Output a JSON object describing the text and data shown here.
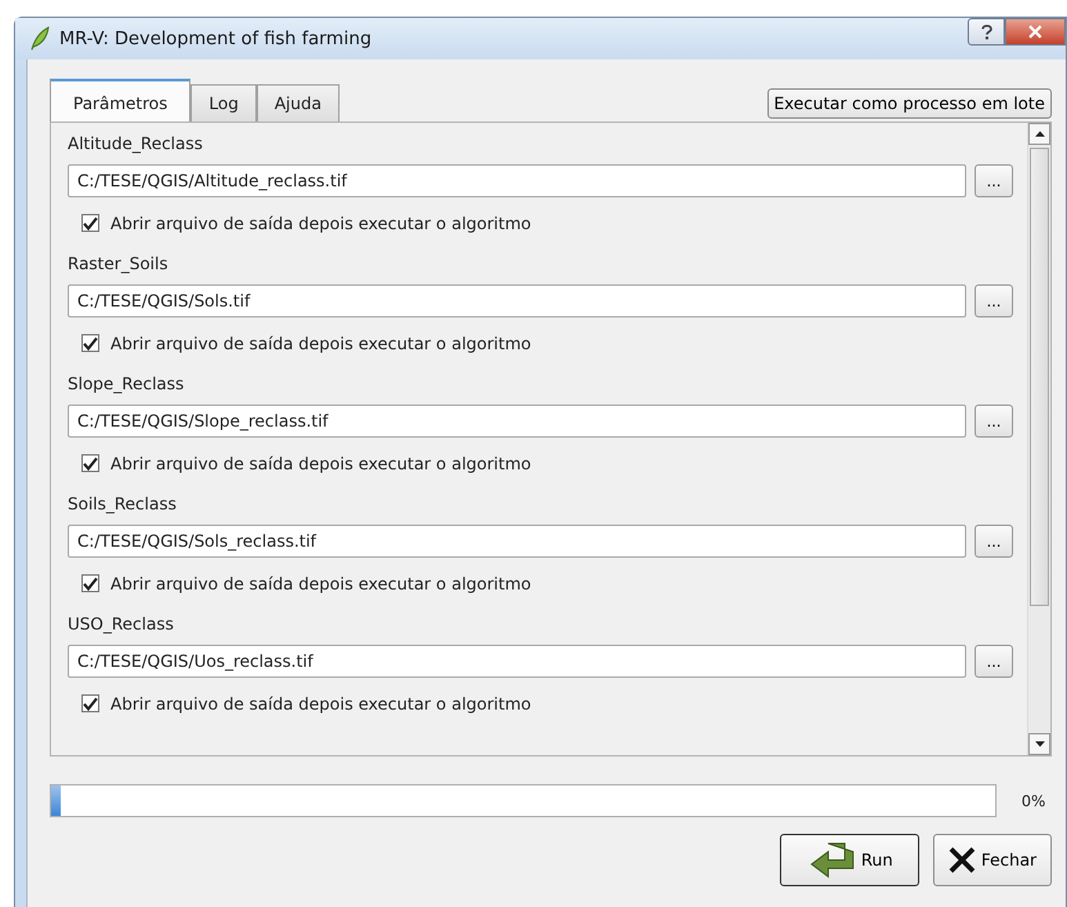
{
  "window": {
    "title": "MR-V: Development of fish farming"
  },
  "tabs": [
    {
      "label": "Parâmetros",
      "selected": true
    },
    {
      "label": "Log",
      "selected": false
    },
    {
      "label": "Ajuda",
      "selected": false
    }
  ],
  "batch_button": "Executar como processo em lote",
  "parameters": [
    {
      "label": "Altitude_Reclass",
      "value": "C:/TESE/QGIS/Altitude_reclass.tif",
      "browse": "...",
      "open_output": {
        "label": "Abrir arquivo de saída depois executar o algoritmo",
        "checked": true
      }
    },
    {
      "label": "Raster_Soils",
      "value": "C:/TESE/QGIS/Sols.tif",
      "browse": "...",
      "open_output": {
        "label": "Abrir arquivo de saída depois executar o algoritmo",
        "checked": true
      }
    },
    {
      "label": "Slope_Reclass",
      "value": "C:/TESE/QGIS/Slope_reclass.tif",
      "browse": "...",
      "open_output": {
        "label": "Abrir arquivo de saída depois executar o algoritmo",
        "checked": true
      }
    },
    {
      "label": "Soils_Reclass",
      "value": "C:/TESE/QGIS/Sols_reclass.tif",
      "browse": "...",
      "open_output": {
        "label": "Abrir arquivo de saída depois executar o algoritmo",
        "checked": true
      }
    },
    {
      "label": "USO_Reclass",
      "value": "C:/TESE/QGIS/Uos_reclass.tif",
      "browse": "...",
      "open_output": {
        "label": "Abrir arquivo de saída depois executar o algoritmo",
        "checked": true
      }
    }
  ],
  "progress": {
    "level": 0.01,
    "reading": "0%"
  },
  "buttons": [
    {
      "label": "Run",
      "kind": "run"
    },
    {
      "label": "Fechar",
      "kind": "close"
    }
  ]
}
